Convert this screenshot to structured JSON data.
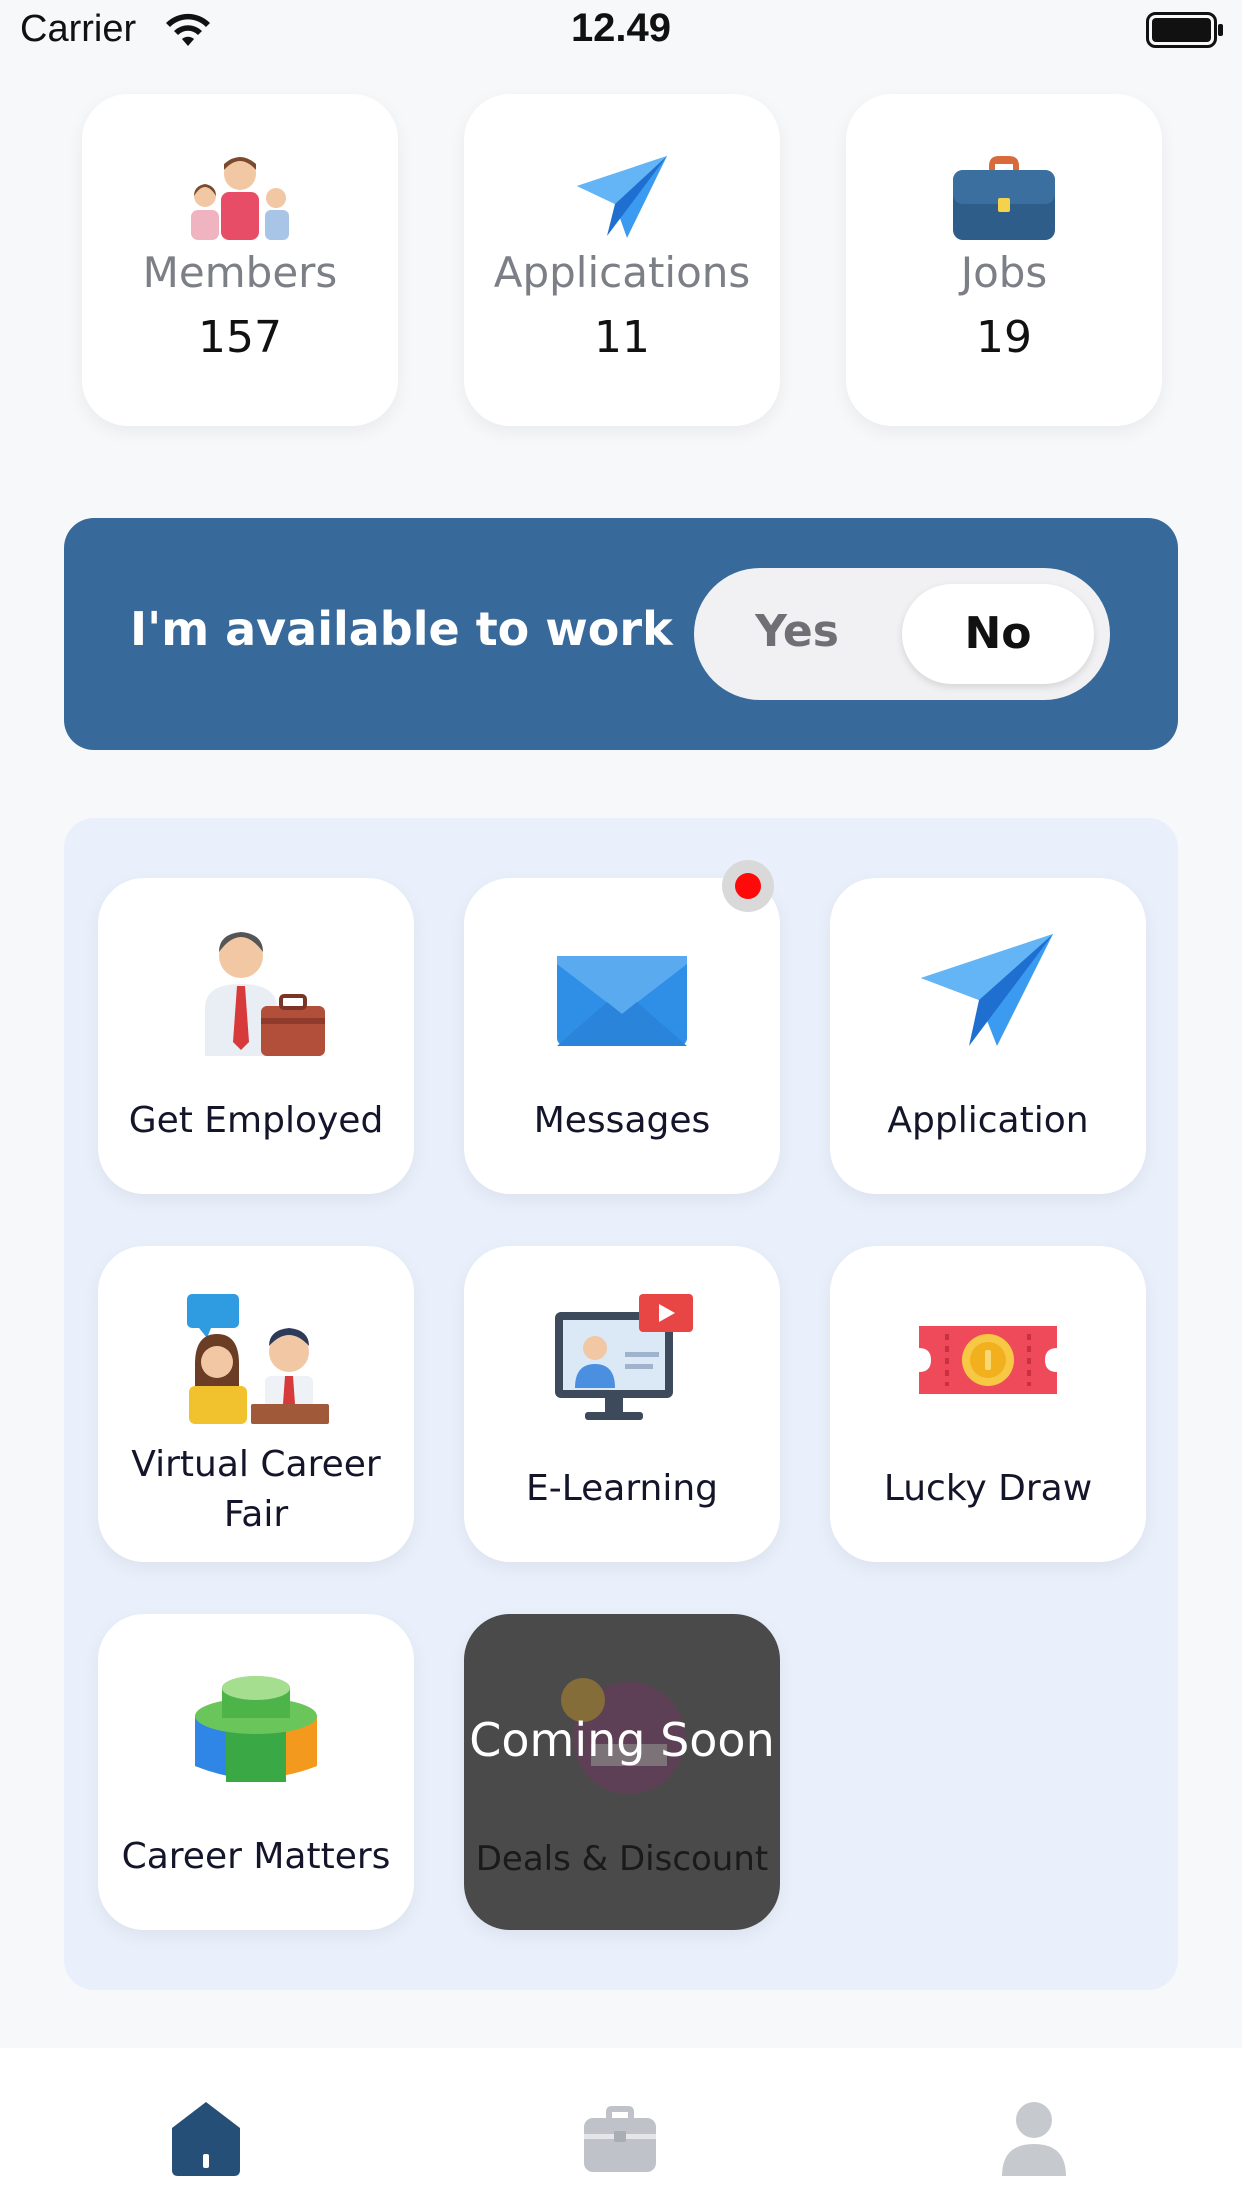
{
  "status_bar": {
    "carrier": "Carrier",
    "time": "12.49"
  },
  "stats": [
    {
      "label": "Members",
      "value": "157",
      "icon": "members-icon"
    },
    {
      "label": "Applications",
      "value": "11",
      "icon": "paper-plane-icon"
    },
    {
      "label": "Jobs",
      "value": "19",
      "icon": "briefcase-icon"
    }
  ],
  "availability": {
    "label": "I'm available to work",
    "yes": "Yes",
    "no": "No",
    "selected": "No"
  },
  "menu": [
    {
      "label": "Get Employed",
      "icon": "employee-briefcase-icon"
    },
    {
      "label": "Messages",
      "icon": "envelope-icon",
      "has_notification": true
    },
    {
      "label": "Application",
      "icon": "paper-plane-icon"
    },
    {
      "label": "Virtual Career Fair",
      "icon": "career-fair-icon"
    },
    {
      "label": "E-Learning",
      "icon": "e-learning-monitor-icon"
    },
    {
      "label": "Lucky Draw",
      "icon": "ticket-icon"
    },
    {
      "label": "Career Matters",
      "icon": "stacked-coins-icon"
    },
    {
      "label": "Deals & Discount",
      "icon": "special-offer-icon",
      "overlay": "Coming Soon"
    }
  ],
  "bottom_nav": [
    {
      "icon": "home-icon",
      "active": true
    },
    {
      "icon": "briefcase-icon",
      "active": false
    },
    {
      "icon": "profile-icon",
      "active": false
    }
  ],
  "colors": {
    "accent": "#376a9a",
    "panel": "#e9f0fb",
    "badge": "#ff0a0a"
  }
}
